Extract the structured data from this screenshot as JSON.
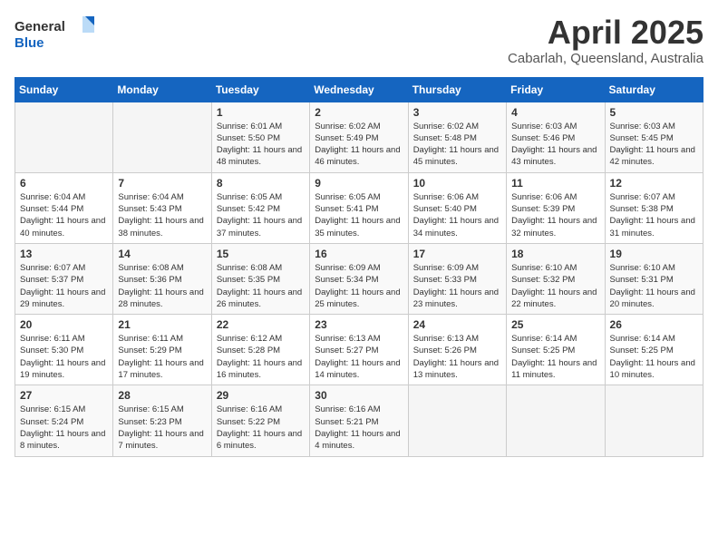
{
  "header": {
    "logo_general": "General",
    "logo_blue": "Blue",
    "month_title": "April 2025",
    "subtitle": "Cabarlah, Queensland, Australia"
  },
  "days_of_week": [
    "Sunday",
    "Monday",
    "Tuesday",
    "Wednesday",
    "Thursday",
    "Friday",
    "Saturday"
  ],
  "weeks": [
    {
      "cells": [
        {
          "day": "",
          "empty": true
        },
        {
          "day": "",
          "empty": true
        },
        {
          "day": "1",
          "sunrise": "Sunrise: 6:01 AM",
          "sunset": "Sunset: 5:50 PM",
          "daylight": "Daylight: 11 hours and 48 minutes."
        },
        {
          "day": "2",
          "sunrise": "Sunrise: 6:02 AM",
          "sunset": "Sunset: 5:49 PM",
          "daylight": "Daylight: 11 hours and 46 minutes."
        },
        {
          "day": "3",
          "sunrise": "Sunrise: 6:02 AM",
          "sunset": "Sunset: 5:48 PM",
          "daylight": "Daylight: 11 hours and 45 minutes."
        },
        {
          "day": "4",
          "sunrise": "Sunrise: 6:03 AM",
          "sunset": "Sunset: 5:46 PM",
          "daylight": "Daylight: 11 hours and 43 minutes."
        },
        {
          "day": "5",
          "sunrise": "Sunrise: 6:03 AM",
          "sunset": "Sunset: 5:45 PM",
          "daylight": "Daylight: 11 hours and 42 minutes."
        }
      ]
    },
    {
      "cells": [
        {
          "day": "6",
          "sunrise": "Sunrise: 6:04 AM",
          "sunset": "Sunset: 5:44 PM",
          "daylight": "Daylight: 11 hours and 40 minutes."
        },
        {
          "day": "7",
          "sunrise": "Sunrise: 6:04 AM",
          "sunset": "Sunset: 5:43 PM",
          "daylight": "Daylight: 11 hours and 38 minutes."
        },
        {
          "day": "8",
          "sunrise": "Sunrise: 6:05 AM",
          "sunset": "Sunset: 5:42 PM",
          "daylight": "Daylight: 11 hours and 37 minutes."
        },
        {
          "day": "9",
          "sunrise": "Sunrise: 6:05 AM",
          "sunset": "Sunset: 5:41 PM",
          "daylight": "Daylight: 11 hours and 35 minutes."
        },
        {
          "day": "10",
          "sunrise": "Sunrise: 6:06 AM",
          "sunset": "Sunset: 5:40 PM",
          "daylight": "Daylight: 11 hours and 34 minutes."
        },
        {
          "day": "11",
          "sunrise": "Sunrise: 6:06 AM",
          "sunset": "Sunset: 5:39 PM",
          "daylight": "Daylight: 11 hours and 32 minutes."
        },
        {
          "day": "12",
          "sunrise": "Sunrise: 6:07 AM",
          "sunset": "Sunset: 5:38 PM",
          "daylight": "Daylight: 11 hours and 31 minutes."
        }
      ]
    },
    {
      "cells": [
        {
          "day": "13",
          "sunrise": "Sunrise: 6:07 AM",
          "sunset": "Sunset: 5:37 PM",
          "daylight": "Daylight: 11 hours and 29 minutes."
        },
        {
          "day": "14",
          "sunrise": "Sunrise: 6:08 AM",
          "sunset": "Sunset: 5:36 PM",
          "daylight": "Daylight: 11 hours and 28 minutes."
        },
        {
          "day": "15",
          "sunrise": "Sunrise: 6:08 AM",
          "sunset": "Sunset: 5:35 PM",
          "daylight": "Daylight: 11 hours and 26 minutes."
        },
        {
          "day": "16",
          "sunrise": "Sunrise: 6:09 AM",
          "sunset": "Sunset: 5:34 PM",
          "daylight": "Daylight: 11 hours and 25 minutes."
        },
        {
          "day": "17",
          "sunrise": "Sunrise: 6:09 AM",
          "sunset": "Sunset: 5:33 PM",
          "daylight": "Daylight: 11 hours and 23 minutes."
        },
        {
          "day": "18",
          "sunrise": "Sunrise: 6:10 AM",
          "sunset": "Sunset: 5:32 PM",
          "daylight": "Daylight: 11 hours and 22 minutes."
        },
        {
          "day": "19",
          "sunrise": "Sunrise: 6:10 AM",
          "sunset": "Sunset: 5:31 PM",
          "daylight": "Daylight: 11 hours and 20 minutes."
        }
      ]
    },
    {
      "cells": [
        {
          "day": "20",
          "sunrise": "Sunrise: 6:11 AM",
          "sunset": "Sunset: 5:30 PM",
          "daylight": "Daylight: 11 hours and 19 minutes."
        },
        {
          "day": "21",
          "sunrise": "Sunrise: 6:11 AM",
          "sunset": "Sunset: 5:29 PM",
          "daylight": "Daylight: 11 hours and 17 minutes."
        },
        {
          "day": "22",
          "sunrise": "Sunrise: 6:12 AM",
          "sunset": "Sunset: 5:28 PM",
          "daylight": "Daylight: 11 hours and 16 minutes."
        },
        {
          "day": "23",
          "sunrise": "Sunrise: 6:13 AM",
          "sunset": "Sunset: 5:27 PM",
          "daylight": "Daylight: 11 hours and 14 minutes."
        },
        {
          "day": "24",
          "sunrise": "Sunrise: 6:13 AM",
          "sunset": "Sunset: 5:26 PM",
          "daylight": "Daylight: 11 hours and 13 minutes."
        },
        {
          "day": "25",
          "sunrise": "Sunrise: 6:14 AM",
          "sunset": "Sunset: 5:25 PM",
          "daylight": "Daylight: 11 hours and 11 minutes."
        },
        {
          "day": "26",
          "sunrise": "Sunrise: 6:14 AM",
          "sunset": "Sunset: 5:25 PM",
          "daylight": "Daylight: 11 hours and 10 minutes."
        }
      ]
    },
    {
      "cells": [
        {
          "day": "27",
          "sunrise": "Sunrise: 6:15 AM",
          "sunset": "Sunset: 5:24 PM",
          "daylight": "Daylight: 11 hours and 8 minutes."
        },
        {
          "day": "28",
          "sunrise": "Sunrise: 6:15 AM",
          "sunset": "Sunset: 5:23 PM",
          "daylight": "Daylight: 11 hours and 7 minutes."
        },
        {
          "day": "29",
          "sunrise": "Sunrise: 6:16 AM",
          "sunset": "Sunset: 5:22 PM",
          "daylight": "Daylight: 11 hours and 6 minutes."
        },
        {
          "day": "30",
          "sunrise": "Sunrise: 6:16 AM",
          "sunset": "Sunset: 5:21 PM",
          "daylight": "Daylight: 11 hours and 4 minutes."
        },
        {
          "day": "",
          "empty": true
        },
        {
          "day": "",
          "empty": true
        },
        {
          "day": "",
          "empty": true
        }
      ]
    }
  ]
}
